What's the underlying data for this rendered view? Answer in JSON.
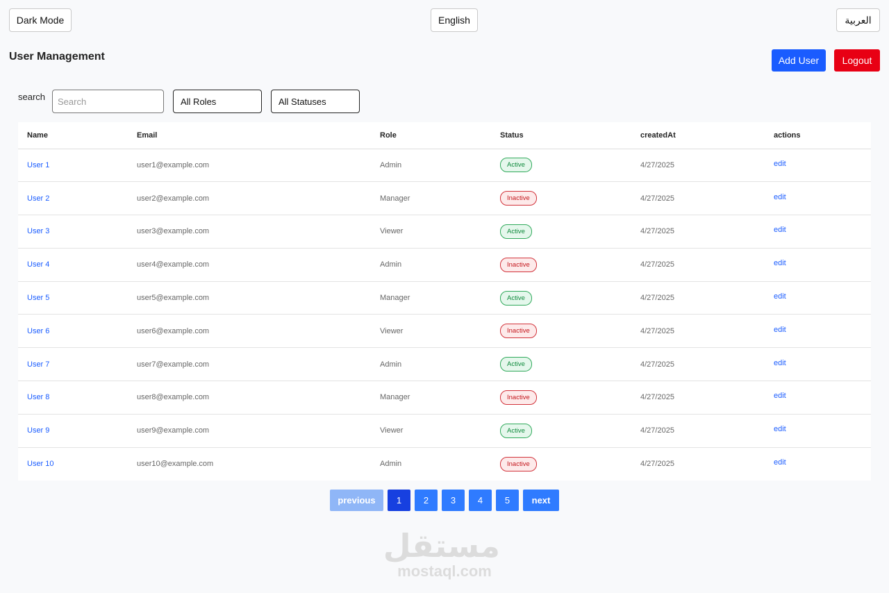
{
  "top_bar": {
    "dark_mode_label": "Dark Mode",
    "english_label": "English",
    "arabic_label": "العربية"
  },
  "header": {
    "title": "User Management",
    "add_user_label": "Add User",
    "logout_label": "Logout"
  },
  "filters": {
    "search_label": "search",
    "search_placeholder": "Search",
    "search_value": "",
    "role_selected": "All Roles",
    "status_selected": "All Statuses"
  },
  "table": {
    "columns": [
      "Name",
      "Email",
      "Role",
      "Status",
      "createdAt",
      "actions"
    ],
    "rows": [
      {
        "name": "User 1",
        "email": "user1@example.com",
        "role": "Admin",
        "status": "Active",
        "created": "4/27/2025",
        "action": "edit"
      },
      {
        "name": "User 2",
        "email": "user2@example.com",
        "role": "Manager",
        "status": "Inactive",
        "created": "4/27/2025",
        "action": "edit"
      },
      {
        "name": "User 3",
        "email": "user3@example.com",
        "role": "Viewer",
        "status": "Active",
        "created": "4/27/2025",
        "action": "edit"
      },
      {
        "name": "User 4",
        "email": "user4@example.com",
        "role": "Admin",
        "status": "Inactive",
        "created": "4/27/2025",
        "action": "edit"
      },
      {
        "name": "User 5",
        "email": "user5@example.com",
        "role": "Manager",
        "status": "Active",
        "created": "4/27/2025",
        "action": "edit"
      },
      {
        "name": "User 6",
        "email": "user6@example.com",
        "role": "Viewer",
        "status": "Inactive",
        "created": "4/27/2025",
        "action": "edit"
      },
      {
        "name": "User 7",
        "email": "user7@example.com",
        "role": "Admin",
        "status": "Active",
        "created": "4/27/2025",
        "action": "edit"
      },
      {
        "name": "User 8",
        "email": "user8@example.com",
        "role": "Manager",
        "status": "Inactive",
        "created": "4/27/2025",
        "action": "edit"
      },
      {
        "name": "User 9",
        "email": "user9@example.com",
        "role": "Viewer",
        "status": "Active",
        "created": "4/27/2025",
        "action": "edit"
      },
      {
        "name": "User 10",
        "email": "user10@example.com",
        "role": "Admin",
        "status": "Inactive",
        "created": "4/27/2025",
        "action": "edit"
      }
    ]
  },
  "pagination": {
    "previous_label": "previous",
    "next_label": "next",
    "pages": [
      "1",
      "2",
      "3",
      "4",
      "5"
    ],
    "current_page": "1"
  },
  "watermark": {
    "arabic": "مستقل",
    "latin": "mostaql.com"
  },
  "colors": {
    "primary": "#1a5cff",
    "danger": "#e80014",
    "active": "#0f8a3c",
    "inactive": "#c4161c",
    "background": "#f8f9fb"
  }
}
